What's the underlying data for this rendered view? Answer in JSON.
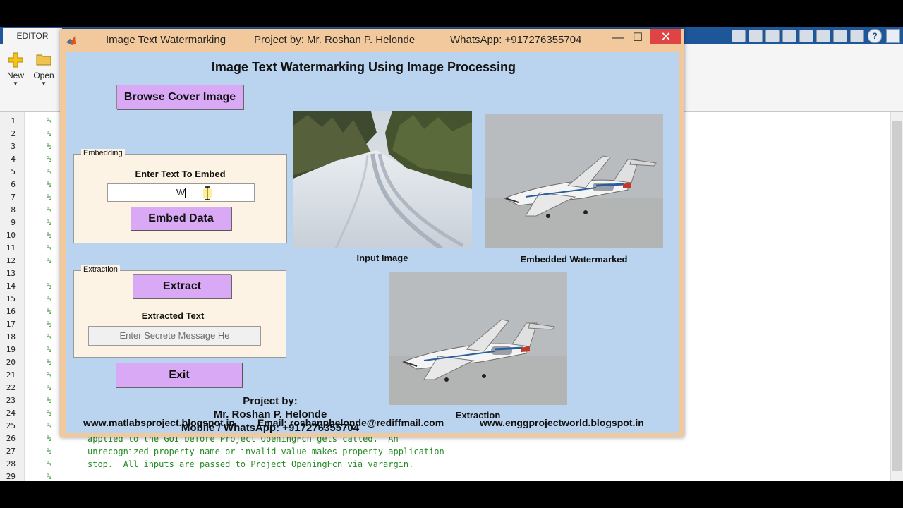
{
  "matlab": {
    "editor_tab": "EDITOR",
    "ribbon_new": "New",
    "ribbon_open": "Open",
    "line_numbers": [
      "1",
      "2",
      "3",
      "4",
      "5",
      "6",
      "7",
      "8",
      "9",
      "10",
      "11",
      "12",
      "13",
      "14",
      "15",
      "16",
      "17",
      "18",
      "19",
      "20",
      "21",
      "22",
      "23",
      "24",
      "25",
      "26",
      "27",
      "28",
      "29"
    ],
    "comment_marker": "%",
    "code_lines": [
      "applied to the GUI before Project OpeningFcn gets called.  An",
      "unrecognized property name or invalid value makes property application",
      "stop.  All inputs are passed to Project OpeningFcn via varargin."
    ]
  },
  "window": {
    "title_app": "Image Text Watermarking",
    "title_project": "Project by: Mr. Roshan P. Helonde",
    "title_whatsapp": "WhatsApp: +917276355704",
    "minimize_glyph": "—",
    "maximize_glyph": "☐",
    "close_glyph": "✕"
  },
  "gui": {
    "heading": "Image Text Watermarking Using Image Processing",
    "browse_button": "Browse Cover Image",
    "embedding": {
      "title": "Embedding",
      "prompt": "Enter Text To Embed",
      "input_value": "W",
      "embed_button": "Embed Data"
    },
    "extraction": {
      "title": "Extraction",
      "extract_button": "Extract",
      "label": "Extracted Text",
      "output_placeholder": "Enter Secrete Message He"
    },
    "exit_button": "Exit",
    "captions": {
      "input": "Input Image",
      "embedded": "Embedded Watermarked",
      "extraction": "Extraction"
    },
    "credits": {
      "line1": "Project by:",
      "line2": "Mr. Roshan P. Helonde",
      "line3": "Mobile / WhatsApp: +917276355704"
    },
    "footer": {
      "site1": "www.matlabsproject.blogspot.in",
      "email": "Email: roshanphelonde@rediffmail.com",
      "site2": "www.enggprojectworld.blogspot.in"
    }
  },
  "colors": {
    "window_frame": "#f2c99c",
    "client_bg": "#bad4f0",
    "button_bg": "#d9a9f5",
    "panel_bg": "#fdf3e4",
    "comment_green": "#228b22"
  },
  "icons": {
    "new": "plus-icon",
    "open": "folder-icon",
    "cursor": "text-cursor-icon",
    "logo": "matlab-logo-icon"
  }
}
